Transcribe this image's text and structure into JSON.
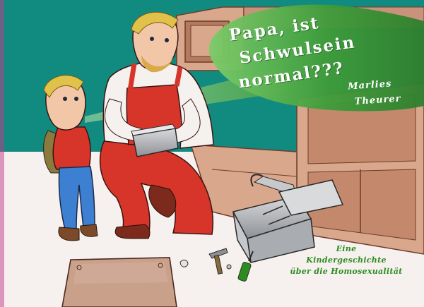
{
  "cover": {
    "title_lines": [
      "Papa, ist",
      "Schwulsein",
      "normal???"
    ],
    "author_lines": [
      "Marlies",
      "Theurer"
    ],
    "subtitle_lines": [
      "Eine",
      "Kindergeschichte",
      "über die Homosexualität"
    ]
  },
  "colors": {
    "wall": "#118a80",
    "wood": "#d9a78c",
    "wood_dark": "#b47a5d",
    "speech_green": "#3f9c3a",
    "subtitle_green": "#2e8b22",
    "overalls_red": "#d8352a",
    "floor": "#f6f1ee"
  },
  "icons": [
    "toolbox-icon",
    "hammer-icon",
    "screwdriver-icon",
    "screw-icon",
    "wooden-board-icon"
  ]
}
